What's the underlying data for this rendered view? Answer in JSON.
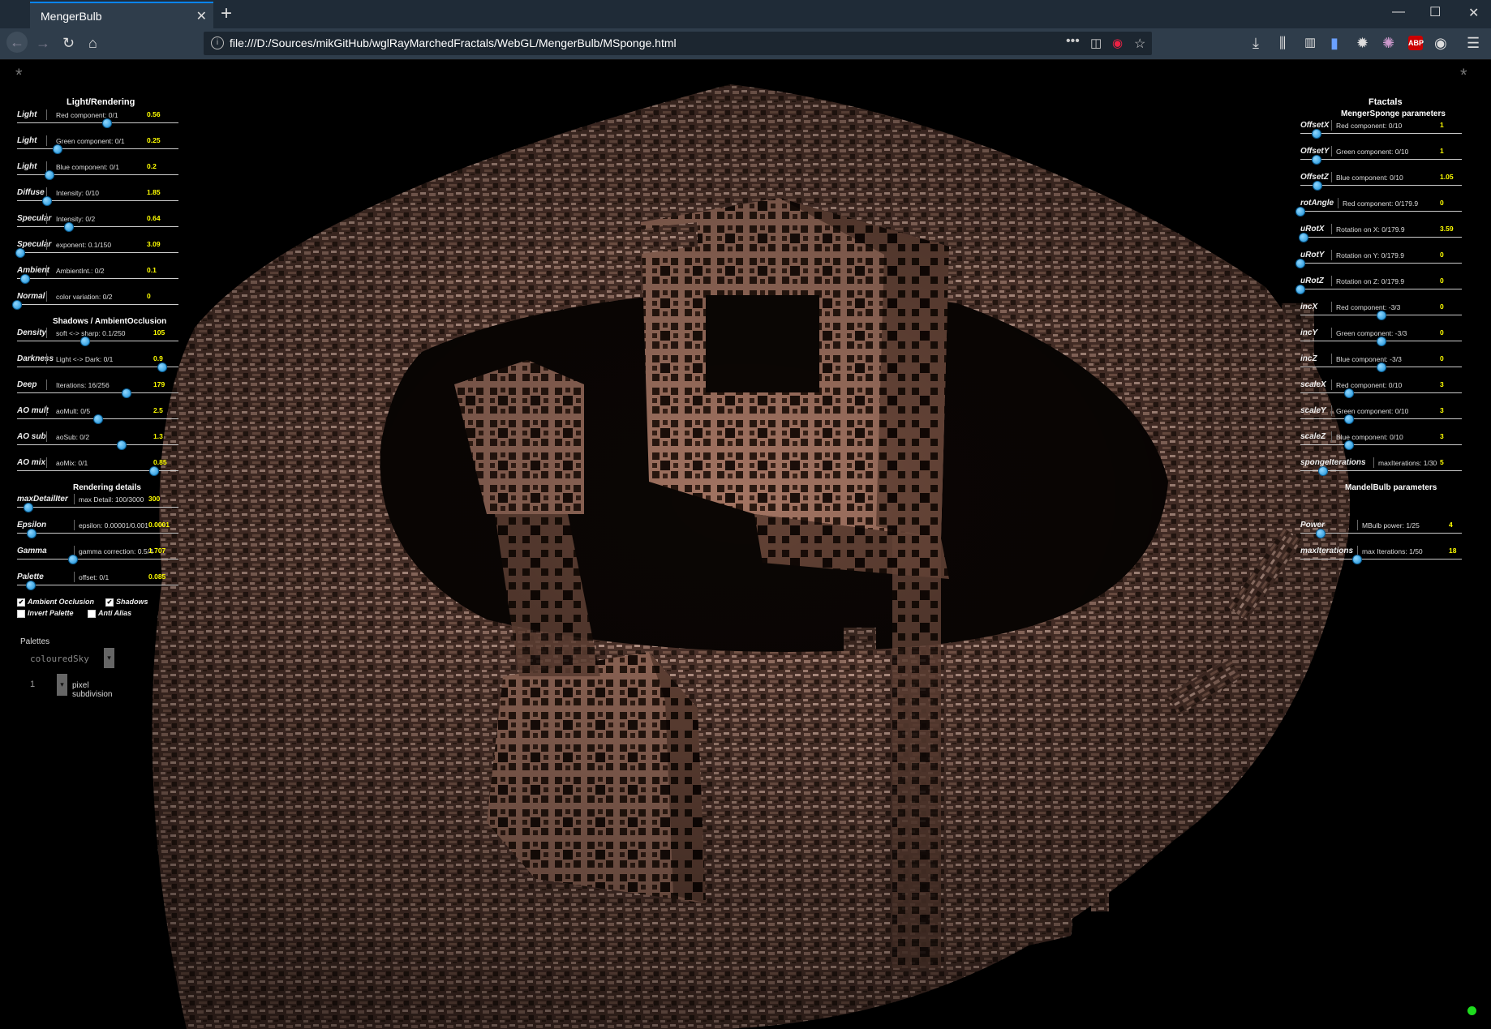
{
  "browser": {
    "tab_title": "MengerBulb",
    "url": "file:///D:/Sources/mikGitHub/wglRayMarchedFractals/WebGL/MengerBulb/MSponge.html"
  },
  "left_panel": {
    "title": "Light/Rendering",
    "rows": [
      {
        "label": "Light",
        "desc": "Red component: 0/1",
        "value": "0.56",
        "fraction": 0.56
      },
      {
        "label": "Light",
        "desc": "Green component: 0/1",
        "value": "0.25",
        "fraction": 0.25
      },
      {
        "label": "Light",
        "desc": "Blue component: 0/1",
        "value": "0.2",
        "fraction": 0.2
      },
      {
        "label": "Diffuse",
        "desc": "Intensity: 0/10",
        "value": "1.85",
        "fraction": 0.185
      },
      {
        "label": "Specular",
        "desc": "Intensity: 0/2",
        "value": "0.64",
        "fraction": 0.32
      },
      {
        "label": "Specular",
        "desc": "exponent: 0.1/150",
        "value": "3.09",
        "fraction": 0.02
      },
      {
        "label": "Ambient",
        "desc": "AmbientInt.: 0/2",
        "value": "0.1",
        "fraction": 0.05
      },
      {
        "label": "Normal",
        "desc": "color variation: 0/2",
        "value": "0",
        "fraction": 0.0
      }
    ],
    "shadows_title": "Shadows / AmbientOcclusion",
    "shadow_rows": [
      {
        "label": "Density",
        "desc": "soft <-> sharp: 0.1/250",
        "value": "105",
        "fraction": 0.42
      },
      {
        "label": "Darkness",
        "desc": "Light <-> Dark: 0/1",
        "value": "0.9",
        "fraction": 0.9
      },
      {
        "label": "Deep",
        "desc": "Iterations: 16/256",
        "value": "179",
        "fraction": 0.68
      },
      {
        "label": "AO mult",
        "desc": "aoMult: 0/5",
        "value": "2.5",
        "fraction": 0.5
      },
      {
        "label": "AO sub",
        "desc": "aoSub: 0/2",
        "value": "1.3",
        "fraction": 0.65
      },
      {
        "label": "AO mix",
        "desc": "aoMix: 0/1",
        "value": "0.85",
        "fraction": 0.85
      }
    ],
    "details_title": "Rendering details",
    "detail_rows": [
      {
        "label": "maxDetailIter",
        "desc": "max Detail: 100/3000",
        "value": "300",
        "fraction": 0.07
      },
      {
        "label": "Epsilon",
        "desc": "epsilon: 0.00001/0.001",
        "value": "0.0001",
        "fraction": 0.09
      },
      {
        "label": "Gamma",
        "desc": "gamma correction: 0.5/4",
        "value": "1.707",
        "fraction": 0.345
      },
      {
        "label": "Palette",
        "desc": "offset: 0/1",
        "value": "0.085",
        "fraction": 0.085
      }
    ],
    "checkboxes": [
      {
        "label": "Ambient Occlusion",
        "checked": true
      },
      {
        "label": "Shadows",
        "checked": true
      },
      {
        "label": "Invert Palette",
        "checked": false
      },
      {
        "label": "Anti Alias",
        "checked": false
      }
    ],
    "palettes_label": "Palettes",
    "palette_value": "colouredSky",
    "subdivision_value": "1",
    "subdivision_label": "pixel subdivision"
  },
  "right_panel": {
    "title": "Ftactals",
    "menger_title": "MengerSponge parameters",
    "rows": [
      {
        "label": "OffsetX",
        "desc": "Red component: 0/10",
        "value": "1",
        "fraction": 0.1
      },
      {
        "label": "OffsetY",
        "desc": "Green component: 0/10",
        "value": "1",
        "fraction": 0.1
      },
      {
        "label": "OffsetZ",
        "desc": "Blue component: 0/10",
        "value": "1.05",
        "fraction": 0.105
      },
      {
        "label": "rotAngle",
        "desc": "Red component: 0/179.9",
        "value": "0",
        "fraction": 0.0
      },
      {
        "label": "uRotX",
        "desc": "Rotation on X: 0/179.9",
        "value": "3.59",
        "fraction": 0.02
      },
      {
        "label": "uRotY",
        "desc": "Rotation on Y: 0/179.9",
        "value": "0",
        "fraction": 0.0
      },
      {
        "label": "uRotZ",
        "desc": "Rotation on Z: 0/179.9",
        "value": "0",
        "fraction": 0.0
      },
      {
        "label": "incX",
        "desc": "Red component: -3/3",
        "value": "0",
        "fraction": 0.5
      },
      {
        "label": "incY",
        "desc": "Green component: -3/3",
        "value": "0",
        "fraction": 0.5
      },
      {
        "label": "incZ",
        "desc": "Blue component: -3/3",
        "value": "0",
        "fraction": 0.5
      },
      {
        "label": "scaleX",
        "desc": "Red component: 0/10",
        "value": "3",
        "fraction": 0.3
      },
      {
        "label": "scaleY",
        "desc": "Green component: 0/10",
        "value": "3",
        "fraction": 0.3
      },
      {
        "label": "scaleZ",
        "desc": "Blue component: 0/10",
        "value": "3",
        "fraction": 0.3
      },
      {
        "label": "spongeIterations",
        "desc": "maxIterations: 1/30",
        "value": "5",
        "fraction": 0.14
      }
    ],
    "mandel_title": "MandelBulb parameters",
    "mandel_rows": [
      {
        "label": "Power",
        "desc": "MBulb power: 1/25",
        "value": "4",
        "fraction": 0.125
      },
      {
        "label": "maxIterations",
        "desc": "max Iterations: 1/50",
        "value": "18",
        "fraction": 0.35
      }
    ]
  },
  "colors": {
    "slider_knob": "#1a8fd6",
    "value_text": "#ffff00",
    "status_dot": "#1edc1e",
    "fractal_base": "#8a5a48"
  },
  "icons": {
    "back": "arrow-left-icon",
    "forward": "arrow-right-icon",
    "reload": "reload-icon",
    "home": "home-icon",
    "menu": "hamburger-menu-icon"
  }
}
